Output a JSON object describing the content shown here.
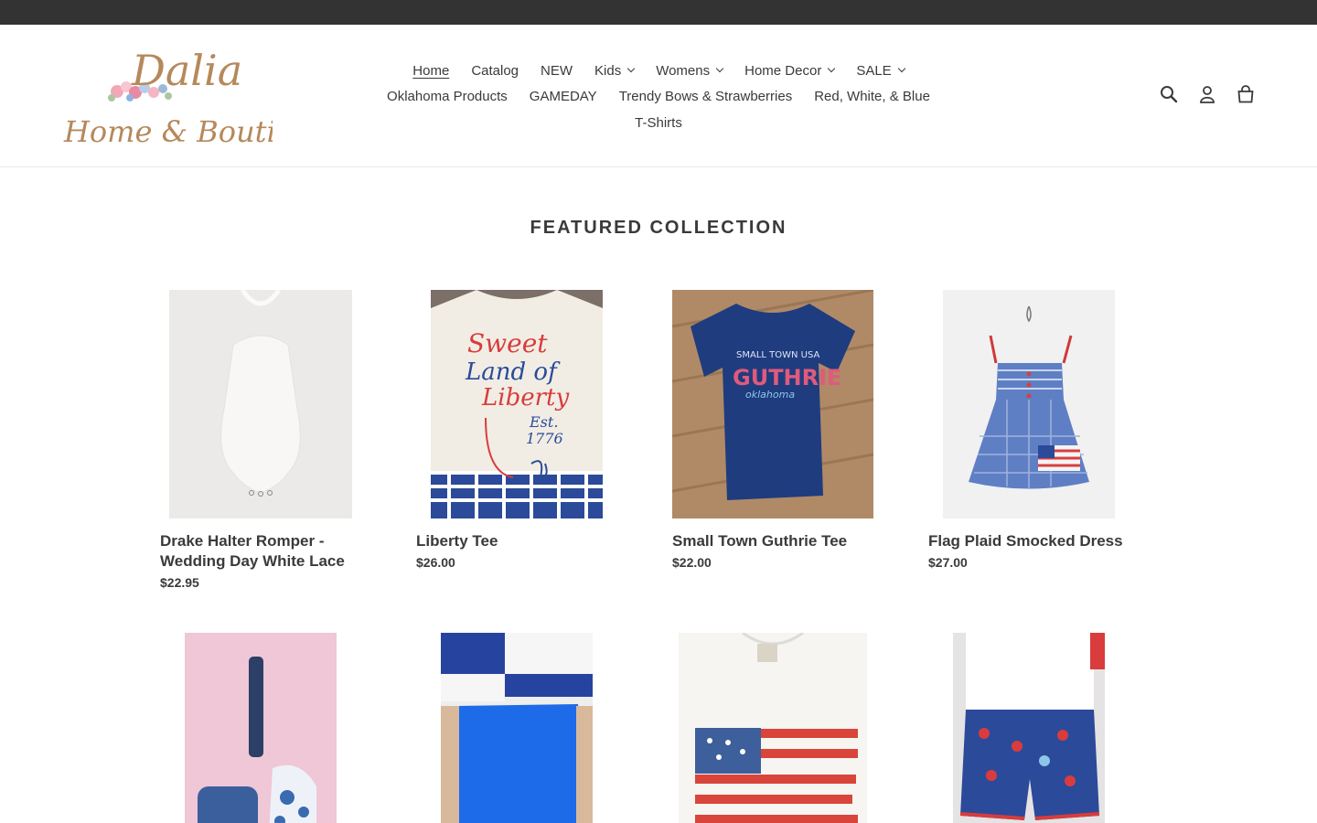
{
  "logo": {
    "line1": "Dalia",
    "line2": "Home & Boutique"
  },
  "nav": {
    "row1": [
      {
        "label": "Home",
        "active": true,
        "dropdown": false
      },
      {
        "label": "Catalog",
        "dropdown": false
      },
      {
        "label": "NEW",
        "dropdown": false
      },
      {
        "label": "Kids",
        "dropdown": true
      },
      {
        "label": "Womens",
        "dropdown": true
      },
      {
        "label": "Home Decor",
        "dropdown": true
      },
      {
        "label": "SALE",
        "dropdown": true
      }
    ],
    "row2": [
      {
        "label": "Oklahoma Products"
      },
      {
        "label": "GAMEDAY"
      },
      {
        "label": "Trendy Bows & Strawberries"
      },
      {
        "label": "Red, White, & Blue"
      }
    ],
    "row3": [
      {
        "label": "T-Shirts"
      }
    ]
  },
  "header_icons": [
    "search-icon",
    "account-icon",
    "cart-icon"
  ],
  "section": {
    "title": "FEATURED COLLECTION"
  },
  "products": [
    {
      "title": "Drake Halter Romper - Wedding Day White Lace",
      "price": "$22.95"
    },
    {
      "title": "Liberty Tee",
      "price": "$26.00"
    },
    {
      "title": "Small Town Guthrie Tee",
      "price": "$22.00"
    },
    {
      "title": "Flag Plaid Smocked Dress",
      "price": "$27.00"
    },
    {
      "title": "",
      "price": ""
    },
    {
      "title": "",
      "price": ""
    },
    {
      "title": "",
      "price": ""
    },
    {
      "title": "",
      "price": ""
    }
  ],
  "image_text": {
    "liberty": [
      "Sweet",
      "Land of",
      "Liberty",
      "Est.",
      "1776"
    ],
    "guthrie": [
      "SMALL TOWN USA",
      "GUTHRIE",
      "oklahoma"
    ]
  },
  "colors": {
    "top_bar": "#333333",
    "text": "#3a3a3a",
    "logo_gold": "#b5895a"
  }
}
